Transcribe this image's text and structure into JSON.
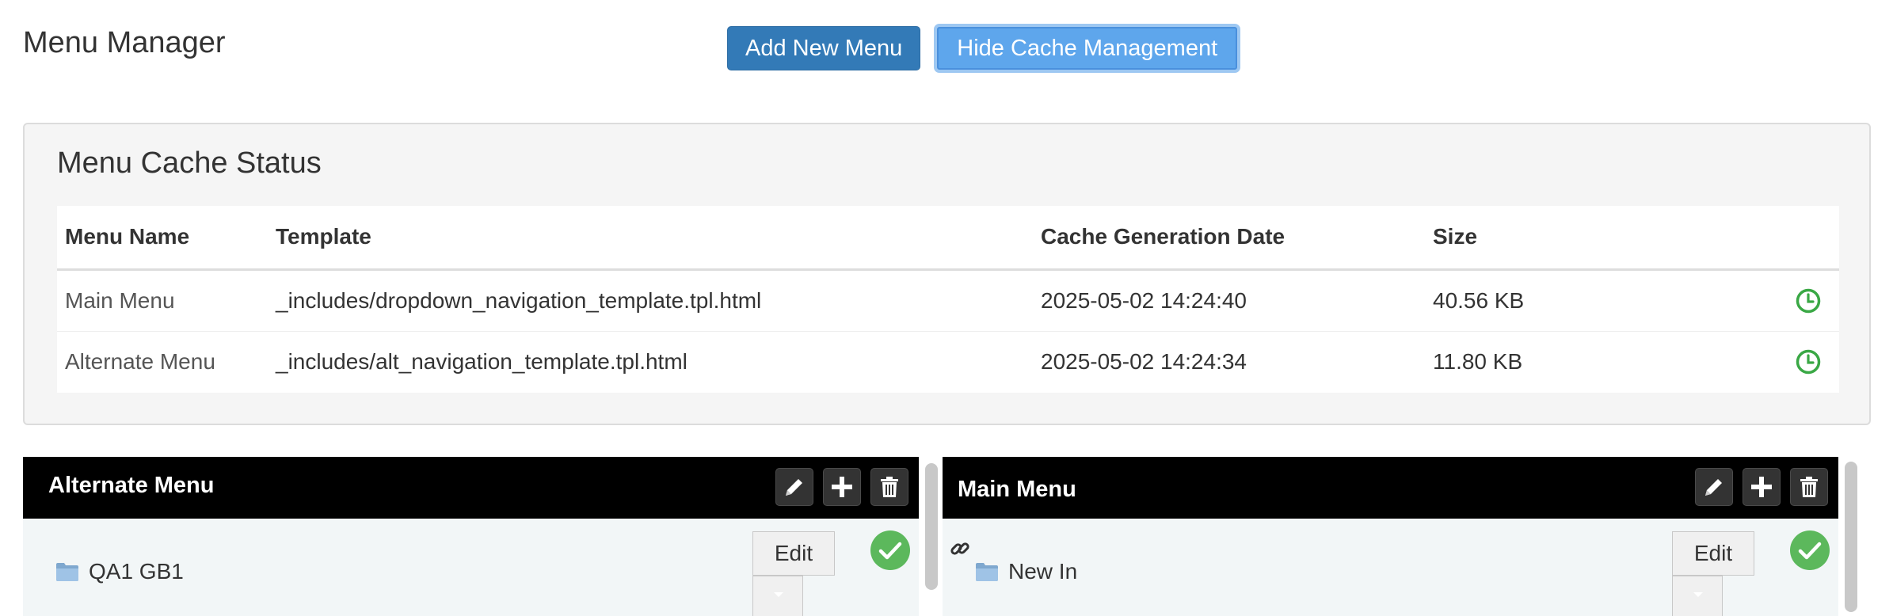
{
  "page": {
    "title": "Menu Manager"
  },
  "toolbar": {
    "add_menu_label": "Add New Menu",
    "hide_cache_label": "Hide Cache Management"
  },
  "cache": {
    "title": "Menu Cache Status",
    "columns": [
      "Menu Name",
      "Template",
      "Cache Generation Date",
      "Size"
    ],
    "rows": [
      {
        "name": "Main Menu",
        "template": "_includes/dropdown_navigation_template.tpl.html",
        "date": "2025-05-02 14:24:40",
        "size": "40.56 KB",
        "action_icon": "clock-icon"
      },
      {
        "name": "Alternate Menu",
        "template": "_includes/alt_navigation_template.tpl.html",
        "date": "2025-05-02 14:24:34",
        "size": "11.80 KB",
        "action_icon": "clock-icon"
      }
    ]
  },
  "menus": [
    {
      "name": "Alternate Menu",
      "edit_label": "Edit",
      "items": [
        {
          "label": "QA1 GB1",
          "icon": "folder-icon"
        }
      ]
    },
    {
      "name": "Main Menu",
      "edit_label": "Edit",
      "items": [
        {
          "label": "New In",
          "icon": "folder-icon",
          "link_icon": "link-icon"
        }
      ]
    }
  ],
  "colors": {
    "primary": "#337ab7",
    "info": "#5ea6ec",
    "success": "#5cb85c",
    "clock_green": "#3aa845",
    "header_bg": "#000000"
  }
}
